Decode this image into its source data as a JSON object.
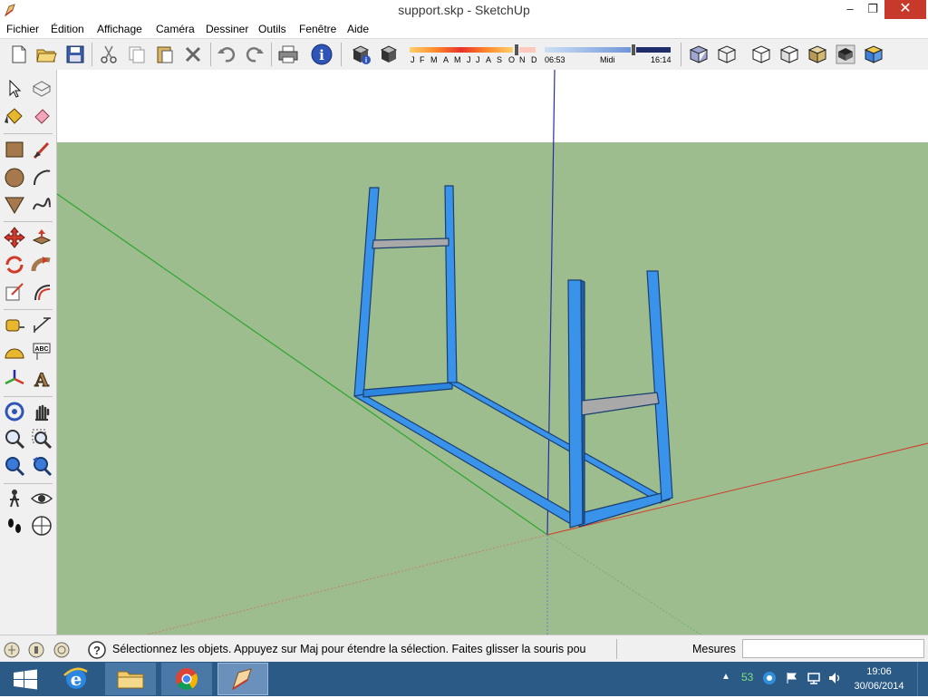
{
  "window": {
    "title": "support.skp - SketchUp",
    "minimize_glyph": "–",
    "restore_glyph": "❐",
    "close_glyph": "✕"
  },
  "menu": {
    "items": [
      "Fichier",
      "Édition",
      "Affichage",
      "Caméra",
      "Dessiner",
      "Outils",
      "Fenêtre",
      "Aide"
    ]
  },
  "toolbar": {
    "buttons": [
      "new-file-icon",
      "open-folder-icon",
      "save-icon",
      "cut-icon",
      "copy-icon",
      "paste-icon",
      "erase-x-icon",
      "undo-icon",
      "redo-icon",
      "print-icon",
      "model-info-icon",
      "shadow-settings-icon",
      "shadow-toggle-icon"
    ],
    "shadow_months": [
      "J",
      "F",
      "M",
      "A",
      "M",
      "J",
      "J",
      "A",
      "S",
      "O",
      "N",
      "D"
    ],
    "shadow_time_start": "06:53",
    "shadow_time_mid": "Midi",
    "shadow_time_end": "16:14",
    "style_buttons": [
      "xray-icon",
      "wireframe-icon",
      "hidden-line-icon",
      "shaded-icon",
      "shaded-textures-icon",
      "monochrome-icon",
      "iso-view-icon"
    ]
  },
  "palette": {
    "tools": [
      "select-icon",
      "make-component-icon",
      "paint-bucket-icon",
      "eraser-icon",
      "rectangle-icon",
      "line-icon",
      "circle-icon",
      "arc-icon",
      "polygon-icon",
      "freehand-icon",
      "move-icon",
      "push-pull-icon",
      "rotate-icon",
      "follow-me-icon",
      "scale-icon",
      "offset-icon",
      "tape-measure-icon",
      "dimension-icon",
      "protractor-icon",
      "text-icon",
      "axes-icon",
      "3d-text-icon",
      "orbit-icon",
      "pan-icon",
      "zoom-icon",
      "zoom-window-icon",
      "zoom-extents-icon",
      "previous-view-icon",
      "position-camera-icon",
      "look-around-icon",
      "walk-icon",
      "section-plane-icon"
    ]
  },
  "statusbar": {
    "hint": "Sélectionnez les objets. Appuyez sur Maj pour étendre la sélection. Faites glisser la souris pou",
    "measures_label": "Mesures",
    "measures_value": ""
  },
  "taskbar": {
    "apps": [
      "windows-start-icon",
      "internet-explorer-icon",
      "file-explorer-icon",
      "chrome-icon",
      "sketchup-icon"
    ],
    "tray_battery": "53",
    "time": "19:06",
    "date": "30/06/2014"
  },
  "colors": {
    "sky": "#ffffff",
    "ground": "#9dbd8f",
    "frame_blue": "#3a93ea",
    "frame_dark": "#1a3e70",
    "crossbar_gray": "#a9a9a9",
    "axis_red": "#d23a2a",
    "axis_green": "#2fa52f",
    "axis_blue": "#2a2aa8"
  }
}
